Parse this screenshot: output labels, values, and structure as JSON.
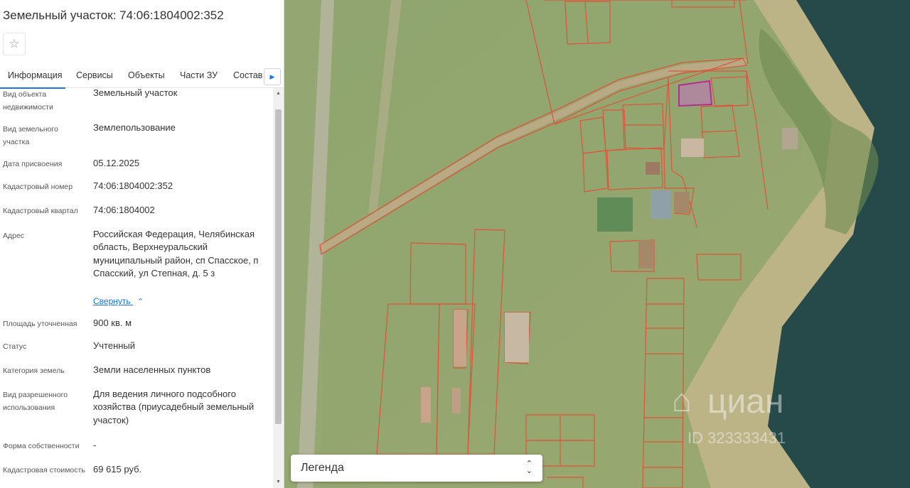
{
  "panel": {
    "title": "Земельный участок: 74:06:1804002:352",
    "favorite_icon": "star-icon",
    "tabs": [
      {
        "label": "Информация",
        "active": true
      },
      {
        "label": "Сервисы",
        "active": false
      },
      {
        "label": "Объекты",
        "active": false
      },
      {
        "label": "Части ЗУ",
        "active": false
      },
      {
        "label": "Состав",
        "active": false
      }
    ],
    "tabs_next_icon": "caret-right-icon",
    "fields": {
      "object_type": {
        "label": "Вид объекта недвижимости",
        "value": "Земельный участок"
      },
      "parcel_type": {
        "label": "Вид земельного участка",
        "value": "Землепользование"
      },
      "assigned_date": {
        "label": "Дата присвоения",
        "value": "05.12.2025"
      },
      "cadastral_number": {
        "label": "Кадастровый номер",
        "value": "74:06:1804002:352"
      },
      "cadastral_quarter": {
        "label": "Кадастровый квартал",
        "value": "74:06:1804002"
      },
      "address": {
        "label": "Адрес",
        "value": "Российская Федерация, Челябинская область, Верхнеуральский муниципальный район, сп Спасское, п Спасский, ул Степная, д. 5 з",
        "collapse_link": "Свернуть"
      },
      "area": {
        "label": "Площадь уточненная",
        "value": "900 кв. м"
      },
      "status": {
        "label": "Статус",
        "value": "Учтенный"
      },
      "land_category": {
        "label": "Категория земель",
        "value": "Земли населенных пунктов"
      },
      "permitted_use": {
        "label": "Вид разрешенного использования",
        "value": "Для ведения личного подсобного хозяйства (приусадебный земельный участок)"
      },
      "ownership": {
        "label": "Форма собственности",
        "value": "-"
      },
      "cadastral_value": {
        "label": "Кадастровая стоимость",
        "value": "69 615 руб."
      }
    }
  },
  "map": {
    "legend_label": "Легенда",
    "legend_toggle_icon": "chevron-up-down-icon",
    "watermark_brand": "циан",
    "watermark_id": "ID 323333431",
    "parcel_border_color": "#e0533a",
    "selected_parcel_color": "#b0308f",
    "water_color": "#26494a"
  }
}
